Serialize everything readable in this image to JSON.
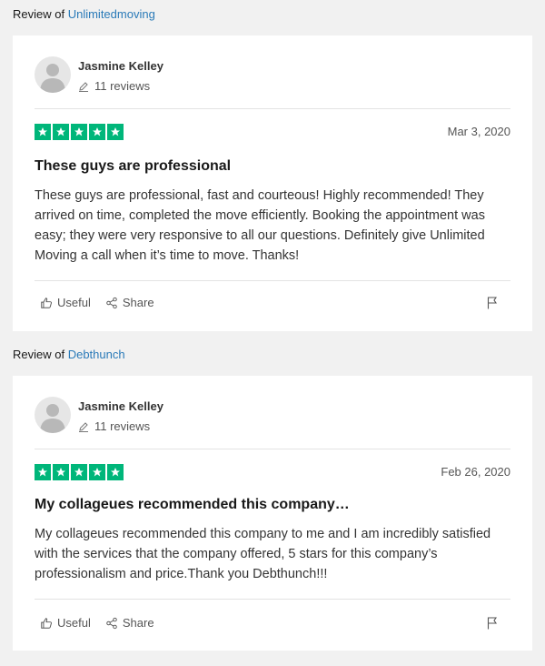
{
  "reviews": [
    {
      "review_of_prefix": "Review of ",
      "company": "Unlimitedmoving",
      "author": "Jasmine Kelley",
      "reviews_count": "11 reviews",
      "rating": 5,
      "date": "Mar 3, 2020",
      "title": "These guys are professional",
      "body": "These guys are professional, fast and courteous! Highly recommended! They arrived on time, completed the move efficiently. Booking the appointment was easy; they were very responsive to all our questions. Definitely give Unlimited Moving a call when it’s time to move. Thanks!",
      "useful_label": "Useful",
      "share_label": "Share"
    },
    {
      "review_of_prefix": "Review of ",
      "company": "Debthunch",
      "author": "Jasmine Kelley",
      "reviews_count": "11 reviews",
      "rating": 5,
      "date": "Feb 26, 2020",
      "title": "My collageues recommended this company…",
      "body": "My collageues recommended this company to me and I am incredibly satisfied with the services that the company offered, 5 stars for this company’s professionalism and price.Thank you Debthunch!!!",
      "useful_label": "Useful",
      "share_label": "Share"
    }
  ],
  "colors": {
    "star_green": "#00b67a",
    "link_blue": "#2a7ab8",
    "page_bg": "#f1f1f1"
  }
}
